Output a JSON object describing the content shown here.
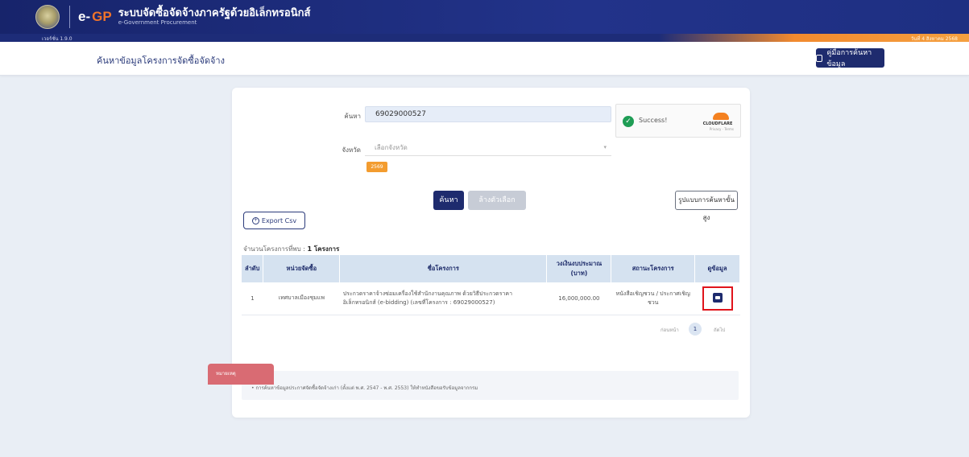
{
  "header": {
    "logo_e": "e-",
    "logo_gp": "GP",
    "title": "ระบบจัดซื้อจัดจ้างภาครัฐด้วยอิเล็กทรอนิกส์",
    "subtitle": "e-Government Procurement",
    "version": "เวอร์ชั่น 1.9.0",
    "date": "วันที่ 4 สิงหาคม 2568"
  },
  "subheader": {
    "page_title": "ค้นหาข้อมูลโครงการจัดซื้อจัดจ้าง",
    "manual_label": "คู่มือการค้นหาข้อมูล"
  },
  "form": {
    "search_label": "ค้นหา",
    "search_value": "69029000527",
    "province_label": "จังหวัด",
    "province_placeholder": "เลือกจังหวัด",
    "tag_label": "2569",
    "search_button": "ค้นหา",
    "clear_button": "ล้างตัวเลือก",
    "advanced_button": "รูปแบบการค้นหาขั้นสูง"
  },
  "captcha": {
    "status": "Success!",
    "brand": "CLOUDFLARE",
    "links": "Privacy · Terms"
  },
  "export": {
    "label": "Export Csv"
  },
  "results": {
    "count_prefix": "จำนวนโครงการที่พบ : ",
    "count": "1 โครงการ",
    "columns": [
      "ลำดับ",
      "หน่วยจัดซื้อ",
      "ชื่อโครงการ",
      "วงเงินงบประมาณ (บาท)",
      "สถานะโครงการ",
      "ดูข้อมูล"
    ],
    "rows": [
      {
        "no": "1",
        "agency": "เทศบาลเมืองชุมแพ",
        "name": "ประกวดราคาจ้างซ่อมเครื่องใช้สำนักงานคุณภาพ ด้วยวิธีประกวดราคาอิเล็กทรอนิกส์ (e-bidding) (เลขที่โครงการ : 69029000527)",
        "budget": "16,000,000.00",
        "status": "หนังสือเชิญชวน / ประกาศเชิญชวน"
      }
    ]
  },
  "pager": {
    "prev": "ก่อนหน้า",
    "page": "1",
    "next": "ถัดไป"
  },
  "notice": {
    "tag": "หมายเหตุ",
    "text": "• การค้นหาข้อมูลประกาศจัดซื้อจัดจ้างเก่า (ตั้งแต่ พ.ศ. 2547 - พ.ศ. 2553) ให้ทำหนังสือขอรับข้อมูลจากกรม"
  },
  "colors": {
    "navy": "#1e2b6e",
    "orange": "#f0732a",
    "highlight": "#e0141b"
  }
}
